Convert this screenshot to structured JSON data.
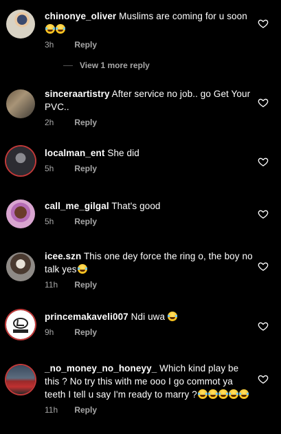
{
  "comments": [
    {
      "user": "chinonye_oliver",
      "text": "Muslims are coming for u soon",
      "emoji_count": 2,
      "time": "3h",
      "reply": "Reply"
    },
    {
      "user": "sinceraartistry",
      "text": "After service no job.. go Get Your PVC..",
      "emoji_count": 0,
      "time": "2h",
      "reply": "Reply"
    },
    {
      "user": "localman_ent",
      "text": "She did",
      "emoji_count": 0,
      "time": "5h",
      "reply": "Reply"
    },
    {
      "user": "call_me_gilgal",
      "text": "That's good",
      "emoji_count": 0,
      "time": "5h",
      "reply": "Reply"
    },
    {
      "user": "icee.szn",
      "text": "This one dey force the ring o, the boy no talk yes",
      "emoji_count": 1,
      "time": "11h",
      "reply": "Reply"
    },
    {
      "user": "princemakaveli007",
      "text": "Ndi uwa",
      "emoji_count": 1,
      "time": "9h",
      "reply": "Reply"
    },
    {
      "user": "_no_money_no_honeyy_",
      "text": "Which kind play be this ? No try this with me ooo I go commot ya teeth I tell u say I'm ready to marry ?",
      "emoji_count": 5,
      "time": "11h",
      "reply": "Reply"
    }
  ],
  "view_more": "View 1 more reply",
  "icons": {
    "like": "heart-outline-icon"
  },
  "colors": {
    "background": "#000000",
    "text": "#ffffff",
    "meta": "#a8a8a8",
    "avatar_ring": "#c23a3a"
  }
}
